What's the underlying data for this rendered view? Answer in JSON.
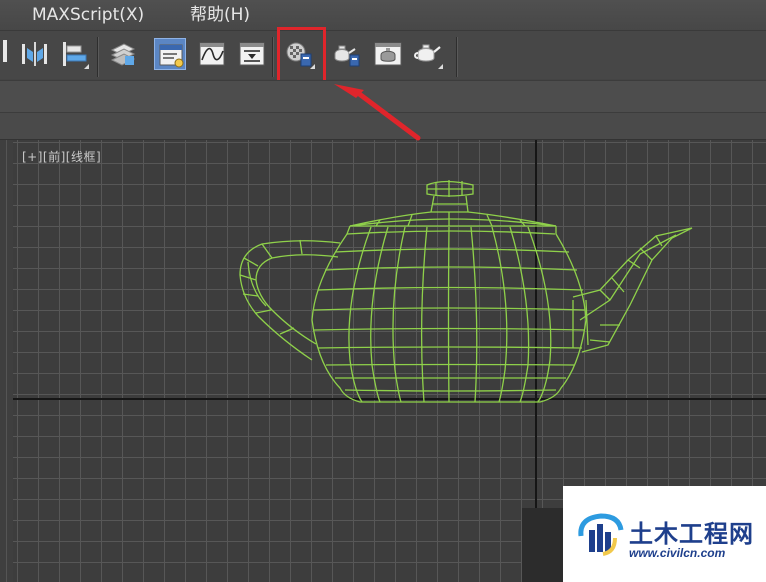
{
  "menu": {
    "items": [
      {
        "label": "MAXScript(X)"
      },
      {
        "label": "帮助(H)"
      }
    ]
  },
  "toolbar": {
    "buttons": [
      {
        "icon": "mirror-icon"
      },
      {
        "icon": "align-icon"
      },
      {
        "icon": "layer-manager-icon"
      },
      {
        "icon": "scene-explorer-icon",
        "active": true
      },
      {
        "icon": "curve-editor-icon"
      },
      {
        "icon": "schematic-view-icon"
      },
      {
        "icon": "material-editor-icon",
        "highlighted": true
      },
      {
        "icon": "render-setup-icon"
      },
      {
        "icon": "rendered-frame-window-icon"
      },
      {
        "icon": "render-production-icon"
      }
    ]
  },
  "viewport": {
    "label": "[+][前][线框]",
    "object_color": "#8fd14a"
  },
  "annotation": {
    "highlight_color": "#e0252b"
  },
  "watermark": {
    "title": "土木工程网",
    "url": "www.civilcn.com",
    "color": "#1e3f8c"
  }
}
